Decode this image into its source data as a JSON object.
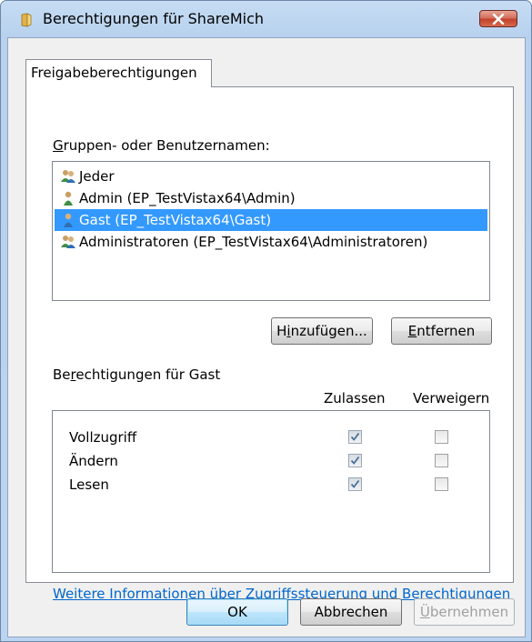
{
  "window": {
    "title": "Berechtigungen für ShareMich"
  },
  "tab": {
    "label": "Freigabeberechtigungen"
  },
  "users": {
    "heading_access": "G",
    "heading_rest": "ruppen- oder Benutzernamen:",
    "items": [
      {
        "label": "Jeder",
        "icon": "group-icon",
        "selected": false
      },
      {
        "label": "Admin (EP_TestVistax64\\Admin)",
        "icon": "user-icon",
        "selected": false
      },
      {
        "label": "Gast (EP_TestVistax64\\Gast)",
        "icon": "user-icon",
        "selected": true
      },
      {
        "label": "Administratoren (EP_TestVistax64\\Administratoren)",
        "icon": "group-icon",
        "selected": false
      }
    ]
  },
  "buttons": {
    "add_pre": "H",
    "add_access": "i",
    "add_post": "nzufügen...",
    "remove_access": "E",
    "remove_post": "ntfernen",
    "ok": "OK",
    "cancel": "Abbrechen",
    "apply_access": "Ü",
    "apply_post": "bernehmen"
  },
  "permissions": {
    "heading_pre": "Be",
    "heading_access": "r",
    "heading_post": "echtigungen für Gast",
    "col_allow": "Zulassen",
    "col_deny": "Verweigern",
    "rows": [
      {
        "name": "Vollzugriff",
        "allow": true,
        "deny": false
      },
      {
        "name": "Ändern",
        "allow": true,
        "deny": false
      },
      {
        "name": "Lesen",
        "allow": true,
        "deny": false
      }
    ]
  },
  "link": {
    "text": "Weitere Informationen über Zugriffssteuerung und Berechtigungen"
  },
  "colors": {
    "selection": "#3399ff",
    "link": "#0066cc",
    "close_button": "#c4412b"
  }
}
